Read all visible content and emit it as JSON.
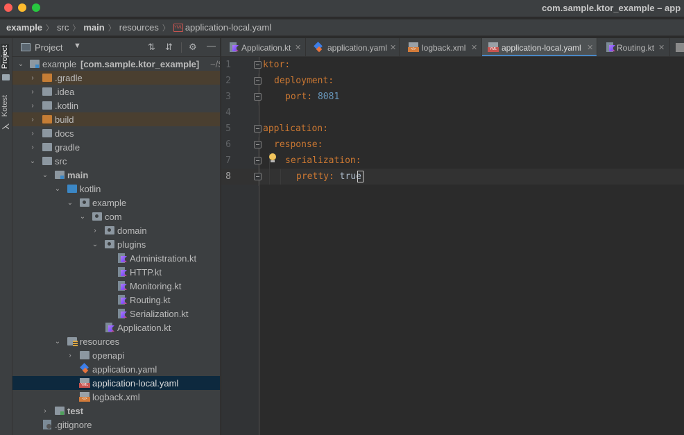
{
  "window": {
    "title": "com.sample.ktor_example – app"
  },
  "breadcrumb": [
    {
      "label": "example",
      "bold": true
    },
    {
      "label": "src",
      "bold": false
    },
    {
      "label": "main",
      "bold": true
    },
    {
      "label": "resources",
      "bold": false
    },
    {
      "label": "application-local.yaml",
      "bold": false
    }
  ],
  "left_stripe": {
    "project": "Project",
    "kotest": "Kotest"
  },
  "project_panel": {
    "title": "Project",
    "root": {
      "name": "example",
      "module": "[com.sample.ktor_example]",
      "path": "~/S"
    },
    "items": [
      {
        "label": ".gradle",
        "kind": "folder-orange",
        "arrow": "collapsed"
      },
      {
        "label": ".idea",
        "kind": "folder",
        "arrow": "collapsed"
      },
      {
        "label": ".kotlin",
        "kind": "folder",
        "arrow": "collapsed"
      },
      {
        "label": "build",
        "kind": "folder-orange",
        "arrow": "collapsed"
      },
      {
        "label": "docs",
        "kind": "folder",
        "arrow": "collapsed"
      },
      {
        "label": "gradle",
        "kind": "folder",
        "arrow": "collapsed"
      },
      {
        "label": "src",
        "kind": "folder",
        "arrow": "expanded"
      },
      {
        "label": "main",
        "kind": "folder",
        "arrow": "expanded"
      },
      {
        "label": "kotlin",
        "kind": "folder-blue",
        "arrow": "expanded"
      },
      {
        "label": "example",
        "kind": "package",
        "arrow": "expanded"
      },
      {
        "label": "com",
        "kind": "package",
        "arrow": "expanded"
      },
      {
        "label": "domain",
        "kind": "package",
        "arrow": "collapsed"
      },
      {
        "label": "plugins",
        "kind": "package",
        "arrow": "expanded"
      },
      {
        "label": "Administration.kt",
        "kind": "kotlin"
      },
      {
        "label": "HTTP.kt",
        "kind": "kotlin"
      },
      {
        "label": "Monitoring.kt",
        "kind": "kotlin"
      },
      {
        "label": "Routing.kt",
        "kind": "kotlin"
      },
      {
        "label": "Serialization.kt",
        "kind": "kotlin"
      },
      {
        "label": "Application.kt",
        "kind": "kotlin"
      },
      {
        "label": "resources",
        "kind": "folder-res",
        "arrow": "expanded"
      },
      {
        "label": "openapi",
        "kind": "folder",
        "arrow": "collapsed"
      },
      {
        "label": "application.yaml",
        "kind": "yaml-blue"
      },
      {
        "label": "application-local.yaml",
        "kind": "yaml"
      },
      {
        "label": "logback.xml",
        "kind": "xml"
      },
      {
        "label": "test",
        "kind": "folder",
        "arrow": "collapsed"
      },
      {
        "label": ".gitignore",
        "kind": "git"
      }
    ]
  },
  "tabs": [
    {
      "label": "Application.kt",
      "icon": "kotlin",
      "active": false
    },
    {
      "label": "application.yaml",
      "icon": "yaml-blue",
      "active": false
    },
    {
      "label": "logback.xml",
      "icon": "xml",
      "active": false
    },
    {
      "label": "application-local.yaml",
      "icon": "yaml",
      "active": true
    },
    {
      "label": "Routing.kt",
      "icon": "kotlin",
      "active": false
    }
  ],
  "editor": {
    "current_line": 8,
    "lines": [
      {
        "n": "1",
        "key": "ktor",
        "value": ""
      },
      {
        "n": "2",
        "key": "deployment",
        "value": ""
      },
      {
        "n": "3",
        "key": "port",
        "value": "8081"
      },
      {
        "n": "4",
        "key": "",
        "value": ""
      },
      {
        "n": "5",
        "key": "application",
        "value": ""
      },
      {
        "n": "6",
        "key": "response",
        "value": ""
      },
      {
        "n": "7",
        "key": "serialization",
        "value": ""
      },
      {
        "n": "8",
        "key": "pretty",
        "value": "true"
      }
    ]
  },
  "colors": {
    "yaml_key": "#cc7832",
    "number": "#6897bb",
    "selection": "#0d293e",
    "excluded_folder": "#c57d35",
    "accent": "#4a88c7"
  }
}
